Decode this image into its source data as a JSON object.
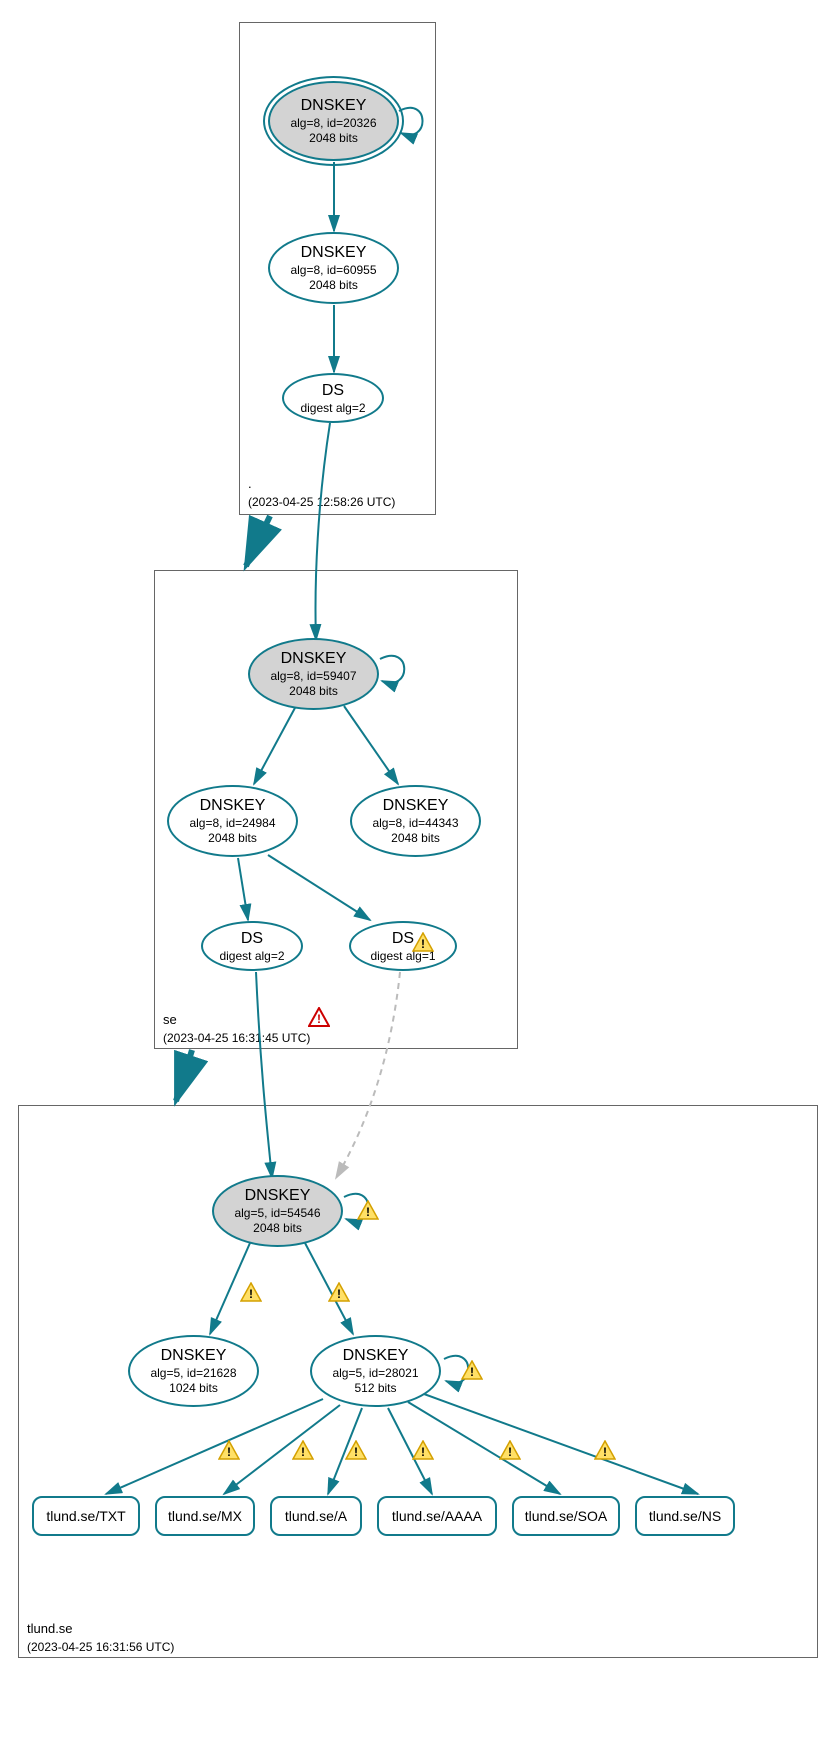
{
  "zones": {
    "root": {
      "name": ".",
      "timestamp": "(2023-04-25 12:58:26 UTC)"
    },
    "se": {
      "name": "se",
      "timestamp": "(2023-04-25 16:31:45 UTC)"
    },
    "tlund": {
      "name": "tlund.se",
      "timestamp": "(2023-04-25 16:31:56 UTC)"
    }
  },
  "nodes": {
    "root_ksk": {
      "title": "DNSKEY",
      "sub": "alg=8, id=20326",
      "sub2": "2048 bits"
    },
    "root_zsk": {
      "title": "DNSKEY",
      "sub": "alg=8, id=60955",
      "sub2": "2048 bits"
    },
    "root_ds": {
      "title": "DS",
      "sub": "digest alg=2"
    },
    "se_ksk": {
      "title": "DNSKEY",
      "sub": "alg=8, id=59407",
      "sub2": "2048 bits"
    },
    "se_zsk1": {
      "title": "DNSKEY",
      "sub": "alg=8, id=24984",
      "sub2": "2048 bits"
    },
    "se_zsk2": {
      "title": "DNSKEY",
      "sub": "alg=8, id=44343",
      "sub2": "2048 bits"
    },
    "se_ds1": {
      "title": "DS",
      "sub": "digest alg=2"
    },
    "se_ds2": {
      "title": "DS",
      "sub": "digest alg=1"
    },
    "tl_ksk": {
      "title": "DNSKEY",
      "sub": "alg=5, id=54546",
      "sub2": "2048 bits"
    },
    "tl_zsk1": {
      "title": "DNSKEY",
      "sub": "alg=5, id=21628",
      "sub2": "1024 bits"
    },
    "tl_zsk2": {
      "title": "DNSKEY",
      "sub": "alg=5, id=28021",
      "sub2": "512 bits"
    }
  },
  "leaves": {
    "txt": "tlund.se/TXT",
    "mx": "tlund.se/MX",
    "a": "tlund.se/A",
    "aaaa": "tlund.se/AAAA",
    "soa": "tlund.se/SOA",
    "ns": "tlund.se/NS"
  },
  "colors": {
    "stroke": "#117a8b",
    "fill_grey": "#d3d3d3",
    "warn_fill": "#ffe066",
    "warn_stroke": "#d4a000",
    "err_fill": "#fff",
    "err_stroke": "#c00"
  }
}
